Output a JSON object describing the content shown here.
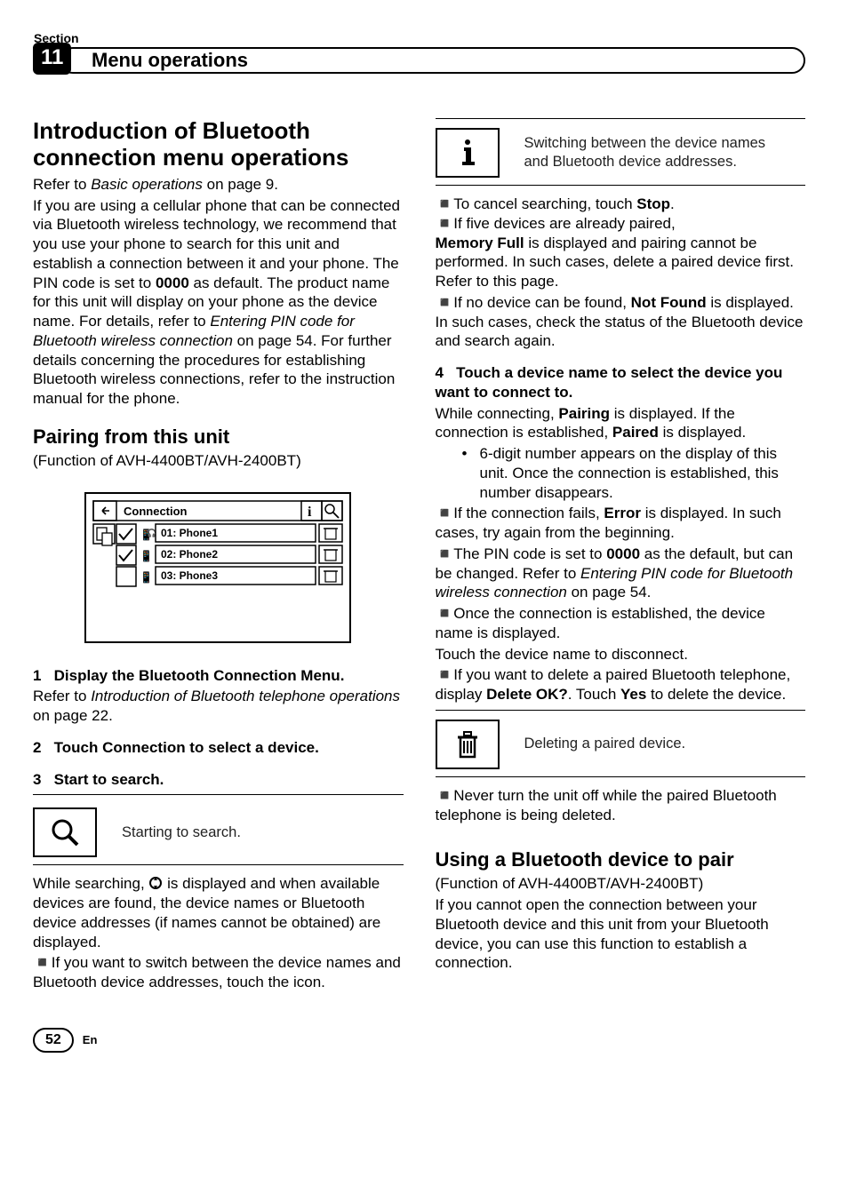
{
  "header": {
    "section_label": "Section",
    "chapter_number": "11",
    "chapter_title": "Menu operations"
  },
  "left": {
    "h1": "Introduction of Bluetooth connection menu operations",
    "intro_pre": "Refer to ",
    "intro_ref": "Basic operations",
    "intro_post": " on page 9.",
    "intro_body_1": "If you are using a cellular phone that can be connected via Bluetooth wireless technology, we recommend that you use your phone to search for this unit and establish a connection between it and your phone. The PIN code is set to ",
    "intro_pin": "0000",
    "intro_body_2": " as default. The product name for this unit will display on your phone as the device name. For details, refer to ",
    "intro_ref2": "Entering PIN code for Bluetooth wireless connection",
    "intro_body_3": " on page 54. For further details concerning the procedures for establishing Bluetooth wireless connections, refer to the instruction manual for the phone.",
    "h2": "Pairing from this unit",
    "func_note": "(Function of AVH-4400BT/AVH-2400BT)",
    "screenshot": {
      "title": "Connection",
      "items": [
        "01: Phone1",
        "02: Phone2",
        "03: Phone3"
      ]
    },
    "step1_num": "1",
    "step1_text": "Display the Bluetooth Connection Menu.",
    "step1_ref_pre": "Refer to ",
    "step1_ref": "Introduction of Bluetooth telephone operations",
    "step1_ref_post": " on page 22.",
    "step2_num": "2",
    "step2_text": "Touch Connection to select a device.",
    "step3_num": "3",
    "step3_text": "Start to search.",
    "search_desc": "Starting to search.",
    "after_search_1": "While searching, ",
    "after_search_2": " is displayed and when available devices are found, the device names or Bluetooth device addresses (if names cannot be obtained) are displayed.",
    "switch_lead": "If you want to switch between the device names and Bluetooth device addresses, touch the icon."
  },
  "right": {
    "info_desc": "Switching between the device names and Bluetooth device addresses.",
    "cancel_pre": "To cancel searching, touch ",
    "cancel_stop": "Stop",
    "cancel_post": ".",
    "five_pre": "If five devices are already paired,",
    "memfull": "Memory Full",
    "memfull_post": " is displayed and pairing cannot be performed. In such cases, delete a paired device first. Refer to this page.",
    "notfound_pre": "If no device can be found, ",
    "notfound": "Not Found",
    "notfound_post": " is displayed. In such cases, check the status of the Bluetooth device and search again.",
    "step4_num": "4",
    "step4_text": "Touch a device name to select the device you want to connect to.",
    "pairing_pre": "While connecting, ",
    "pairing": "Pairing",
    "pairing_mid": " is displayed. If the connection is established, ",
    "paired": "Paired",
    "pairing_post": " is displayed.",
    "dot6": "6-digit number appears on the display of this unit. Once the connection is established, this number disappears.",
    "error_pre": "If the connection fails, ",
    "error": "Error",
    "error_post": " is displayed. In such cases, try again from the beginning.",
    "pin_pre": "The PIN code is set to ",
    "pin_code": "0000",
    "pin_mid": " as the default, but can be changed. Refer to ",
    "pin_ref": "Entering PIN code for Bluetooth wireless connection",
    "pin_post": " on page 54.",
    "once_line": "Once the connection is established, the device name is displayed.",
    "touch_disconnect": "Touch the device name to disconnect.",
    "delete_pre": "If you want to delete a paired Bluetooth telephone, display ",
    "delete_ok": "Delete OK?",
    "delete_mid": ". Touch ",
    "delete_yes": "Yes",
    "delete_post": " to delete the device.",
    "trash_desc": "Deleting a paired device.",
    "never_off": "Never turn the unit off while the paired Bluetooth telephone is being deleted.",
    "h3": "Using a Bluetooth device to pair",
    "func_note2": "(Function of AVH-4400BT/AVH-2400BT)",
    "last_para": "If you cannot open the connection between your Bluetooth device and this unit from your Bluetooth device, you can use this function to establish a connection."
  },
  "footer": {
    "page_number": "52",
    "lang": "En"
  }
}
